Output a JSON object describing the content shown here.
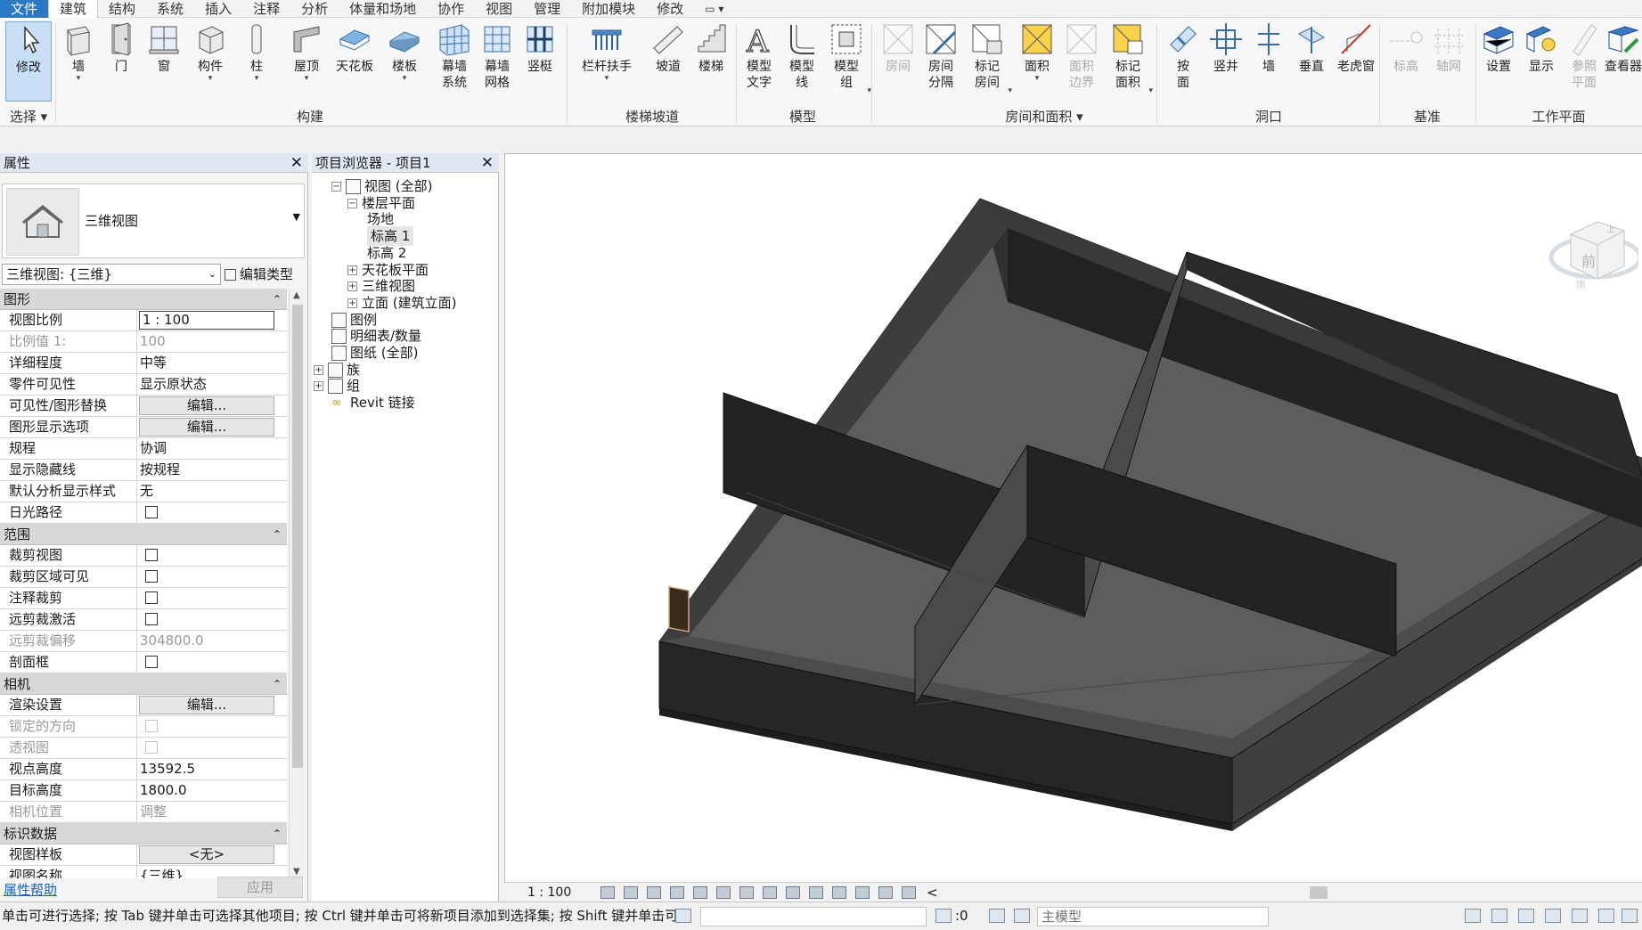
{
  "menu": {
    "file": "文件",
    "tabs": [
      "建筑",
      "结构",
      "系统",
      "插入",
      "注释",
      "分析",
      "体量和场地",
      "协作",
      "视图",
      "管理",
      "附加模块",
      "修改"
    ],
    "active_tab": "建筑",
    "quick_dropdown": "▭ ▾"
  },
  "ribbon": {
    "tools": {
      "modify": "修改",
      "wall": "墙",
      "door": "门",
      "window": "窗",
      "component": "构件",
      "column": "柱",
      "roof": "屋顶",
      "ceiling": "天花板",
      "floor": "楼板",
      "curtain_system": "幕墙\n系统",
      "curtain_grid": "幕墙\n网格",
      "mullion": "竖梃",
      "railing": "栏杆扶手",
      "ramp": "坡道",
      "stair": "楼梯",
      "model_text": "模型\n文字",
      "model_line": "模型\n线",
      "model_group": "模型\n组",
      "room": "房间",
      "room_separator": "房间\n分隔",
      "tag_room": "标记\n房间",
      "area": "面积",
      "area_boundary": "面积\n边界",
      "tag_area": "标记\n面积",
      "by_face": "按\n面",
      "shaft": "竖井",
      "wall_opening": "墙",
      "vertical": "垂直",
      "dormer": "老虎窗",
      "level": "标高",
      "grid": "轴网",
      "set": "设置",
      "show": "显示",
      "ref_plane": "参照\n平面",
      "viewer": "查看器"
    },
    "panels": {
      "select": "选择",
      "build": "构建",
      "circulation": "楼梯坡道",
      "model": "模型",
      "room_area": "房间和面积",
      "opening": "洞口",
      "datum": "基准",
      "work_plane": "工作平面"
    }
  },
  "properties": {
    "title": "属性",
    "type_name": "三维视图",
    "instance_selector": "三维视图: {三维}",
    "edit_type": "编辑类型",
    "groups": [
      {
        "name": "图形",
        "rows": [
          {
            "k": "视图比例",
            "v": "1 : 100",
            "kind": "edit"
          },
          {
            "k": "比例值 1:",
            "v": "100",
            "kind": "disabled"
          },
          {
            "k": "详细程度",
            "v": "中等",
            "kind": "text"
          },
          {
            "k": "零件可见性",
            "v": "显示原状态",
            "kind": "text"
          },
          {
            "k": "可见性/图形替换",
            "v": "编辑...",
            "kind": "button"
          },
          {
            "k": "图形显示选项",
            "v": "编辑...",
            "kind": "button"
          },
          {
            "k": "规程",
            "v": "协调",
            "kind": "text"
          },
          {
            "k": "显示隐藏线",
            "v": "按规程",
            "kind": "text"
          },
          {
            "k": "默认分析显示样式",
            "v": "无",
            "kind": "text"
          },
          {
            "k": "日光路径",
            "v": "",
            "kind": "check"
          }
        ]
      },
      {
        "name": "范围",
        "rows": [
          {
            "k": "裁剪视图",
            "v": "",
            "kind": "check"
          },
          {
            "k": "裁剪区域可见",
            "v": "",
            "kind": "check"
          },
          {
            "k": "注释裁剪",
            "v": "",
            "kind": "check"
          },
          {
            "k": "远剪裁激活",
            "v": "",
            "kind": "check"
          },
          {
            "k": "远剪裁偏移",
            "v": "304800.0",
            "kind": "disabled"
          },
          {
            "k": "剖面框",
            "v": "",
            "kind": "check"
          }
        ]
      },
      {
        "name": "相机",
        "rows": [
          {
            "k": "渲染设置",
            "v": "编辑...",
            "kind": "button"
          },
          {
            "k": "锁定的方向",
            "v": "",
            "kind": "check-disabled"
          },
          {
            "k": "透视图",
            "v": "",
            "kind": "check-disabled"
          },
          {
            "k": "视点高度",
            "v": "13592.5",
            "kind": "text"
          },
          {
            "k": "目标高度",
            "v": "1800.0",
            "kind": "text"
          },
          {
            "k": "相机位置",
            "v": "调整",
            "kind": "disabled"
          }
        ]
      },
      {
        "name": "标识数据",
        "rows": [
          {
            "k": "视图样板",
            "v": "<无>",
            "kind": "button"
          },
          {
            "k": "视图名称",
            "v": "{三维}",
            "kind": "text"
          }
        ]
      }
    ],
    "help_link": "属性帮助",
    "apply": "应用"
  },
  "browser": {
    "title": "项目浏览器 - 项目1",
    "items": [
      {
        "label": "视图 (全部)",
        "exp": "−"
      },
      {
        "label": "楼层平面",
        "exp": "−"
      },
      {
        "label": "场地"
      },
      {
        "label": "标高 1",
        "selected": true
      },
      {
        "label": "标高 2"
      },
      {
        "label": "天花板平面",
        "exp": "+"
      },
      {
        "label": "三维视图",
        "exp": "+"
      },
      {
        "label": "立面 (建筑立面)",
        "exp": "+"
      },
      {
        "label": "图例"
      },
      {
        "label": "明细表/数量"
      },
      {
        "label": "图纸 (全部)"
      },
      {
        "label": "族",
        "exp": "+"
      },
      {
        "label": "组",
        "exp": "+"
      },
      {
        "label": "Revit 链接"
      }
    ]
  },
  "viewcube": {
    "face": "前",
    "top": "上",
    "compass": "南"
  },
  "view_control_bar": {
    "scale": "1 : 100",
    "chevron": "<"
  },
  "status": {
    "message": "单击可进行选择; 按 Tab 键并单击可选择其他项目; 按 Ctrl 键并单击可将新项目添加到选择集; 按 Shift 键并单击可",
    "zero": ":0",
    "model": "主模型"
  },
  "colors": {
    "accent": "#2b78c5",
    "wall_dark": "#2a2a2a",
    "floor_grey": "#5a5a5a",
    "select_bg": "#c9dff5"
  }
}
